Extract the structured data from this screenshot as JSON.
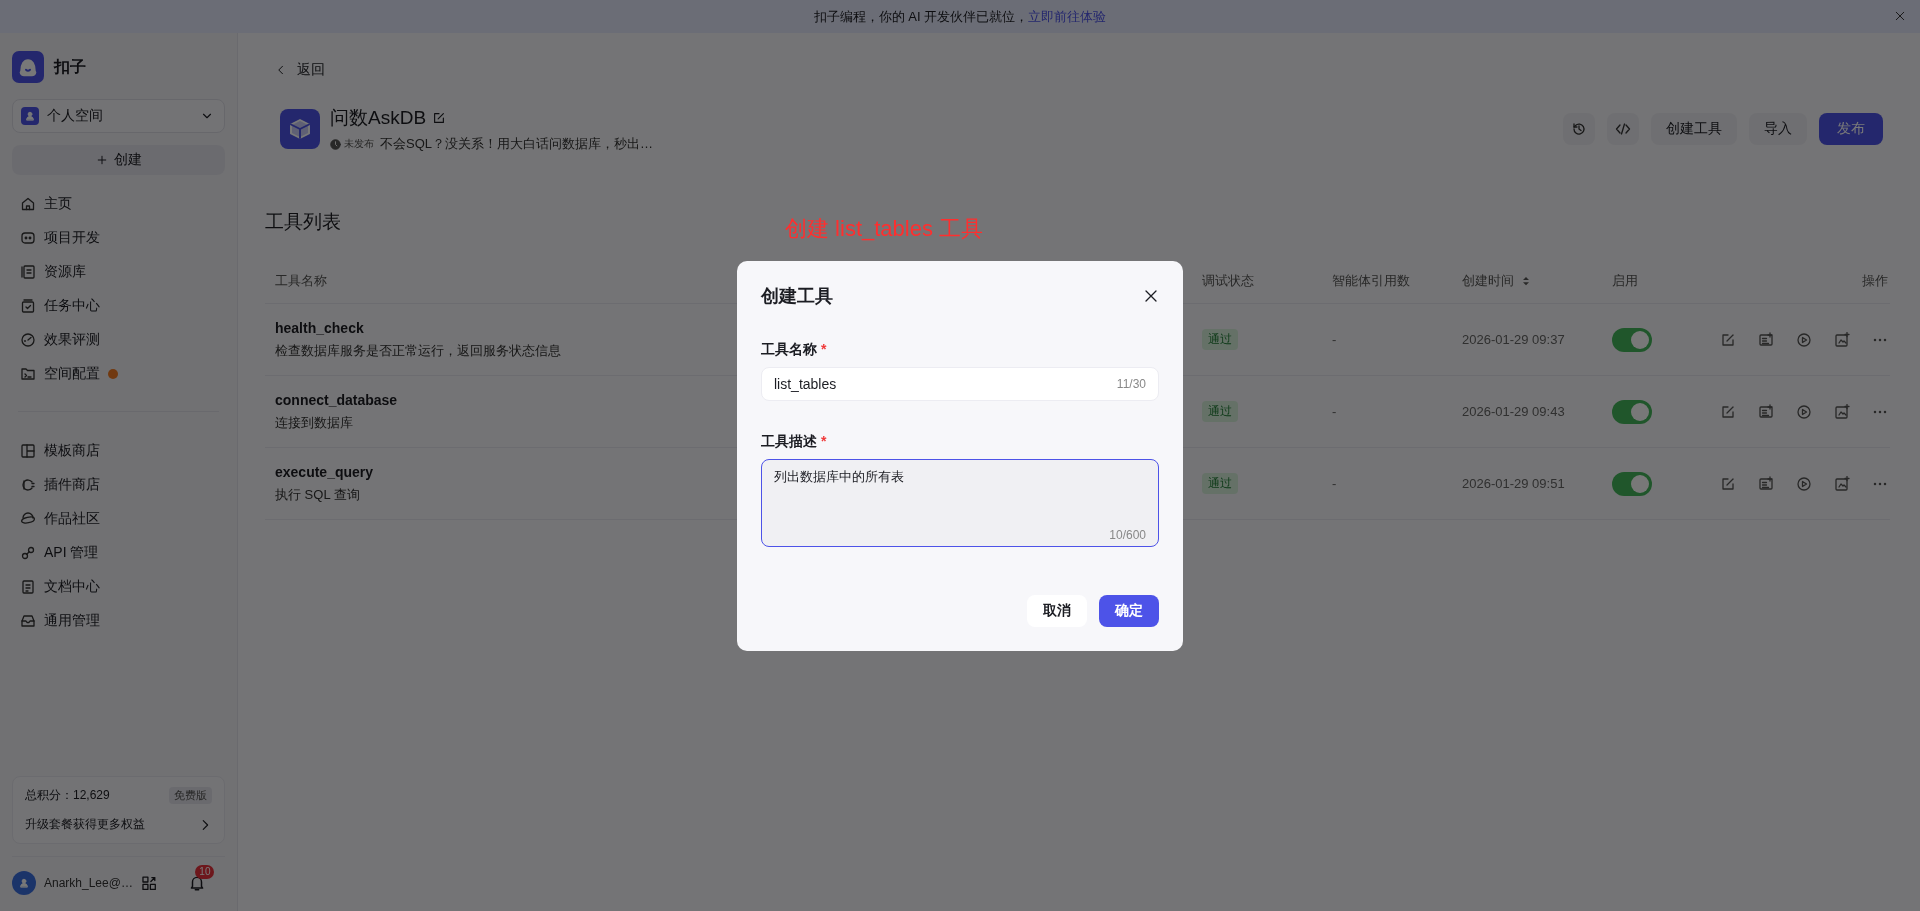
{
  "banner": {
    "text": "扣子编程，你的 AI 开发伙伴已就位，",
    "link": "立即前往体验"
  },
  "sidebar": {
    "brand": "扣子",
    "space": "个人空间",
    "create": "创建",
    "nav_groups": [
      [
        {
          "label": "主页",
          "notice": false
        },
        {
          "label": "项目开发",
          "notice": false
        },
        {
          "label": "资源库",
          "notice": false
        },
        {
          "label": "任务中心",
          "notice": false
        },
        {
          "label": "效果评测",
          "notice": false
        },
        {
          "label": "空间配置",
          "notice": true
        }
      ],
      [
        {
          "label": "模板商店",
          "notice": false
        },
        {
          "label": "插件商店",
          "notice": false
        },
        {
          "label": "作品社区",
          "notice": false
        },
        {
          "label": "API 管理",
          "notice": false
        },
        {
          "label": "文档中心",
          "notice": false
        },
        {
          "label": "通用管理",
          "notice": false
        }
      ]
    ],
    "points": {
      "label": "总积分：12,629",
      "plan": "免费版",
      "upgrade": "升级套餐获得更多权益"
    },
    "user": {
      "name": "Anarkh_Lee@…",
      "notifications": "10"
    }
  },
  "header": {
    "back": "返回",
    "title": "问数AskDB",
    "status": "未发布",
    "description": "不会SQL？没关系！用大白话问数据库，秒出…",
    "actions": [
      {
        "label": "创建工具",
        "primary": false
      },
      {
        "label": "导入",
        "primary": false
      },
      {
        "label": "发布",
        "primary": true
      }
    ]
  },
  "tools": {
    "title": "工具列表",
    "columns": [
      {
        "label": "工具名称",
        "sortable": false
      },
      {
        "label": "调试状态",
        "sortable": false
      },
      {
        "label": "智能体引用数",
        "sortable": false
      },
      {
        "label": "创建时间",
        "sortable": true
      },
      {
        "label": "启用",
        "sortable": false
      },
      {
        "label": "操作",
        "sortable": false
      }
    ],
    "rows": [
      {
        "name": "health_check",
        "description": "检查数据库服务是否正常运行，返回服务状态信息",
        "debug_status": "通过",
        "references": "-",
        "created": "2026-01-29 09:37",
        "enabled": true
      },
      {
        "name": "connect_database",
        "description": "连接到数据库",
        "debug_status": "通过",
        "references": "-",
        "created": "2026-01-29 09:43",
        "enabled": true
      },
      {
        "name": "execute_query",
        "description": "执行 SQL 查询",
        "debug_status": "通过",
        "references": "-",
        "created": "2026-01-29 09:51",
        "enabled": true
      }
    ]
  },
  "annotation": "创建 list_tables 工具",
  "dialog": {
    "title": "创建工具",
    "fields": [
      {
        "kind": "input",
        "label": "工具名称",
        "required_mark": "*",
        "value": "list_tables",
        "counter": "11/30",
        "focused": false
      },
      {
        "kind": "textarea",
        "label": "工具描述",
        "required_mark": "*",
        "value": "列出数据库中的所有表",
        "counter": "10/600",
        "focused": true
      }
    ],
    "buttons": [
      {
        "label": "取消",
        "primary": false
      },
      {
        "label": "确定",
        "primary": true
      }
    ]
  }
}
